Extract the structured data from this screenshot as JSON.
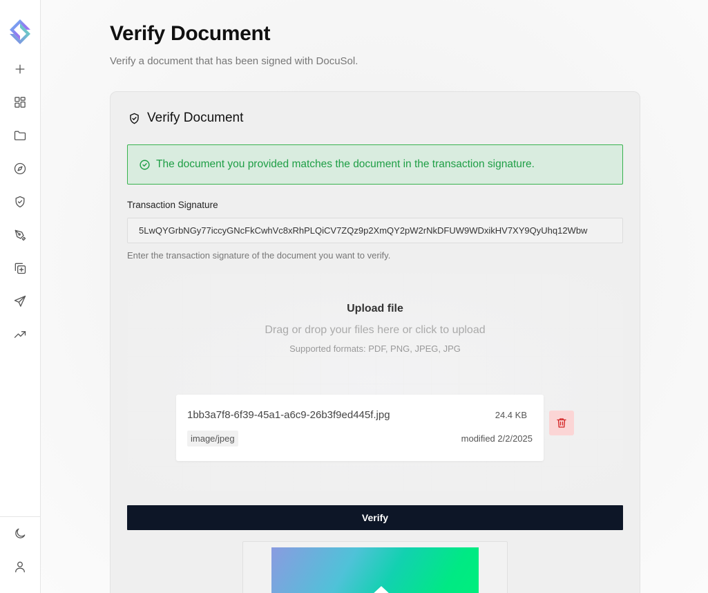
{
  "sidebar": {
    "logo": "docusol-logo-icon",
    "items": [
      {
        "icon": "plus-icon"
      },
      {
        "icon": "dashboard-grid-icon"
      },
      {
        "icon": "folder-icon"
      },
      {
        "icon": "compass-icon"
      },
      {
        "icon": "shield-check-icon"
      },
      {
        "icon": "pen-tool-icon"
      },
      {
        "icon": "copy-plus-icon"
      },
      {
        "icon": "send-icon"
      },
      {
        "icon": "trending-up-icon"
      }
    ],
    "bottom": [
      {
        "icon": "moon-icon"
      },
      {
        "icon": "user-icon"
      }
    ]
  },
  "page": {
    "title": "Verify Document",
    "subtitle": "Verify a document that has been signed with DocuSol."
  },
  "card": {
    "title": "Verify Document",
    "alert": {
      "text": "The document you provided matches the document in the transaction signature.",
      "color": "#1e9e45"
    },
    "signature": {
      "label": "Transaction Signature",
      "value": "5LwQYGrbNGy77iccyGNcFkCwhVc8xRhPLQiCV7ZQz9p2XmQY2pW2rNkDFUW9WDxikHV7XY9QyUhq12Wbw",
      "help": "Enter the transaction signature of the document you want to verify."
    },
    "upload": {
      "title": "Upload file",
      "hint": "Drag or drop your files here or click to upload",
      "formats": "Supported formats: PDF, PNG, JPEG, JPG"
    },
    "file": {
      "name": "1bb3a7f8-6f39-45a1-a6c9-26b3f9ed445f.jpg",
      "size": "24.4 KB",
      "type": "image/jpeg",
      "modified": "modified 2/2/2025"
    },
    "verify_label": "Verify"
  },
  "colors": {
    "primary_button": "#0d1627",
    "success_bg": "#d9ecdf",
    "danger": "#d32424"
  }
}
